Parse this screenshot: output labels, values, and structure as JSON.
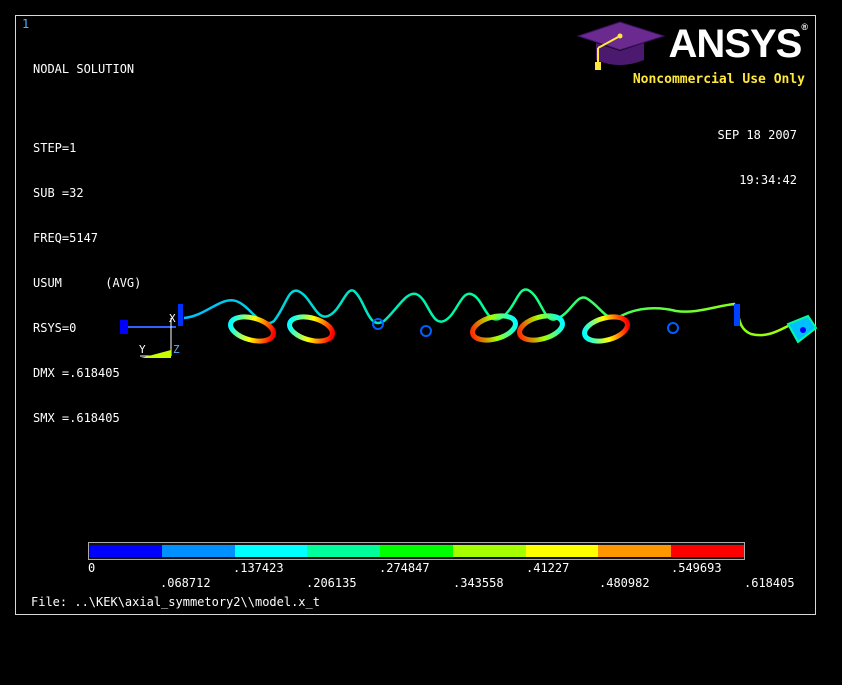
{
  "window_number": "1",
  "info": {
    "title": "NODAL SOLUTION",
    "lines": [
      "STEP=1",
      "SUB =32",
      "FREQ=5147",
      "USUM      (AVG)",
      "RSYS=0",
      "DMX =.618405",
      "SMX =.618405"
    ]
  },
  "logo": {
    "text": "ANSYS",
    "registered": "®",
    "license": "Noncommercial Use Only"
  },
  "datetime": {
    "date": "SEP 18 2007",
    "time": "19:34:42"
  },
  "triad": {
    "x": "X",
    "y": "Y",
    "z": "Z"
  },
  "legend": {
    "colors": [
      "#0000ff",
      "#0090ff",
      "#00ffff",
      "#00ff9a",
      "#00ff00",
      "#a6ff00",
      "#ffff00",
      "#ff9600",
      "#ff0000"
    ],
    "labels_top": [
      "0",
      ".137423",
      ".274847",
      ".41227",
      ".549693"
    ],
    "labels_bottom": [
      ".068712",
      ".206135",
      ".343558",
      ".480982",
      ".618405"
    ]
  },
  "file": "File: ..\\KEK\\axial_symmetory2\\\\model.x_t"
}
